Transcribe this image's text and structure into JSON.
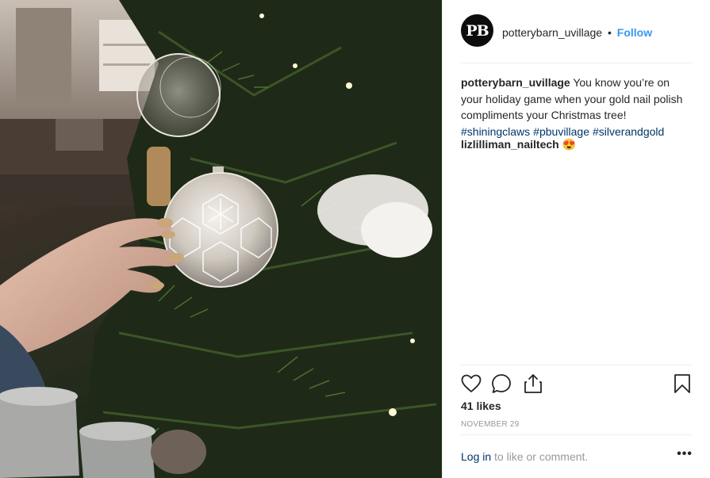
{
  "post": {
    "photo_alt": "",
    "author": {
      "avatar_text": "PB",
      "username": "potterybarn_uvillage",
      "separator": "•",
      "follow_label": "Follow"
    },
    "caption": {
      "username": "potterybarn_uvillage",
      "text": "You know you’re on your holiday game when your gold nail polish compliments your Christmas tree!",
      "hashtags": [
        "#shiningclaws",
        "#pbuvillage",
        "#silverandgold"
      ]
    },
    "comments": [
      {
        "username": "lizlilliman_nailtech",
        "text": "😍"
      }
    ],
    "actions": {
      "like_icon": "heart-icon",
      "comment_icon": "comment-bubble-icon",
      "share_icon": "share-upload-icon",
      "save_icon": "bookmark-icon"
    },
    "likes_text": "41 likes",
    "date_text": "NOVEMBER 29",
    "login_prompt": {
      "link_text": "Log in",
      "rest_text": " to like or comment.",
      "more_label": "•••"
    }
  },
  "colors": {
    "link_blue": "#3897f0",
    "hashtag_navy": "#003569",
    "muted_gray": "#999999",
    "divider": "#efefef"
  }
}
